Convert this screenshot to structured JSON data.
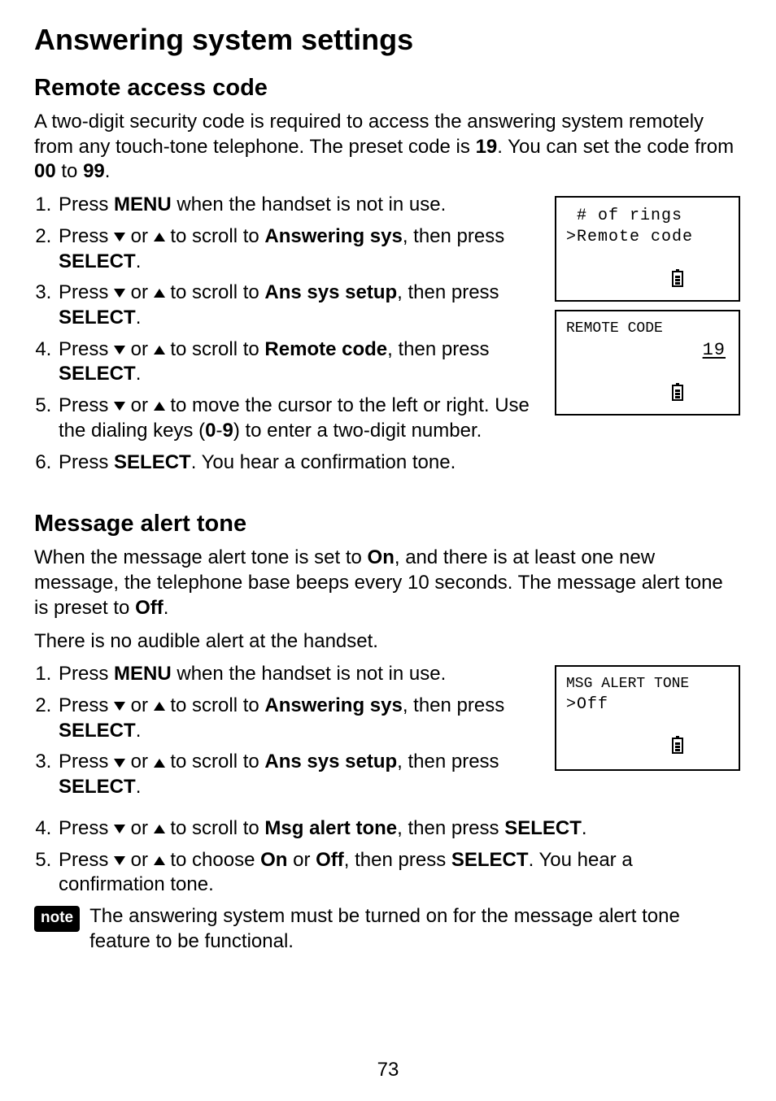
{
  "page_title": "Answering system settings",
  "page_number": "73",
  "sections": {
    "remote": {
      "heading": "Remote access code",
      "intro_html": "A two-digit security code is required to access the answering system remotely from any touch-tone telephone. The preset code is <b>19</b>. You can set the code from <b>00</b> to <b>99</b>.",
      "steps": [
        "Press <b>MENU</b> when the handset is not in use.",
        "Press {down} or {up} to scroll to <b>Answering sys</b>, then press <b>SELECT</b>.",
        "Press {down} or {up} to scroll to <b>Ans sys setup</b>, then press <b>SELECT</b>.",
        "Press {down} or {up} to scroll to <b>Remote code</b>, then press <b>SELECT</b>.",
        "Press {down} or {up} to move the cursor to the left or right. Use the dialing keys (<b>0</b>-<b>9</b>) to enter a two-digit number.",
        "Press <b>SELECT</b>. You hear a confirmation tone."
      ],
      "lcd1": {
        "line1": " # of rings",
        "line2": ">Remote code"
      },
      "lcd2": {
        "title": "REMOTE CODE",
        "value": "19"
      }
    },
    "msg_alert": {
      "heading": "Message alert tone",
      "intro_html": "When the message alert tone is set to <b>On</b>, and there is at least one new message, the telephone base beeps every 10 seconds. The message alert tone is preset to <b>Off</b>.",
      "intro2": "There is no audible alert at the handset.",
      "steps": [
        "Press <b>MENU</b> when the handset is not in use.",
        "Press {down} or {up} to scroll to <b>Answering sys</b>, then press <b>SELECT</b>.",
        "Press {down} or {up} to scroll to <b>Ans sys setup</b>, then press <b>SELECT</b>.",
        "Press {down} or {up} to scroll to <b>Msg alert tone</b>, then press <b>SELECT</b>.",
        "Press {down} or {up} to choose <b>On</b> or <b>Off</b>, then press <b>SELECT</b>. You hear a confirmation tone."
      ],
      "lcd": {
        "title": "MSG ALERT TONE",
        "line2": ">Off"
      },
      "note_label": "note",
      "note_text": "The answering system must be turned on for the message alert tone feature to be functional."
    }
  }
}
